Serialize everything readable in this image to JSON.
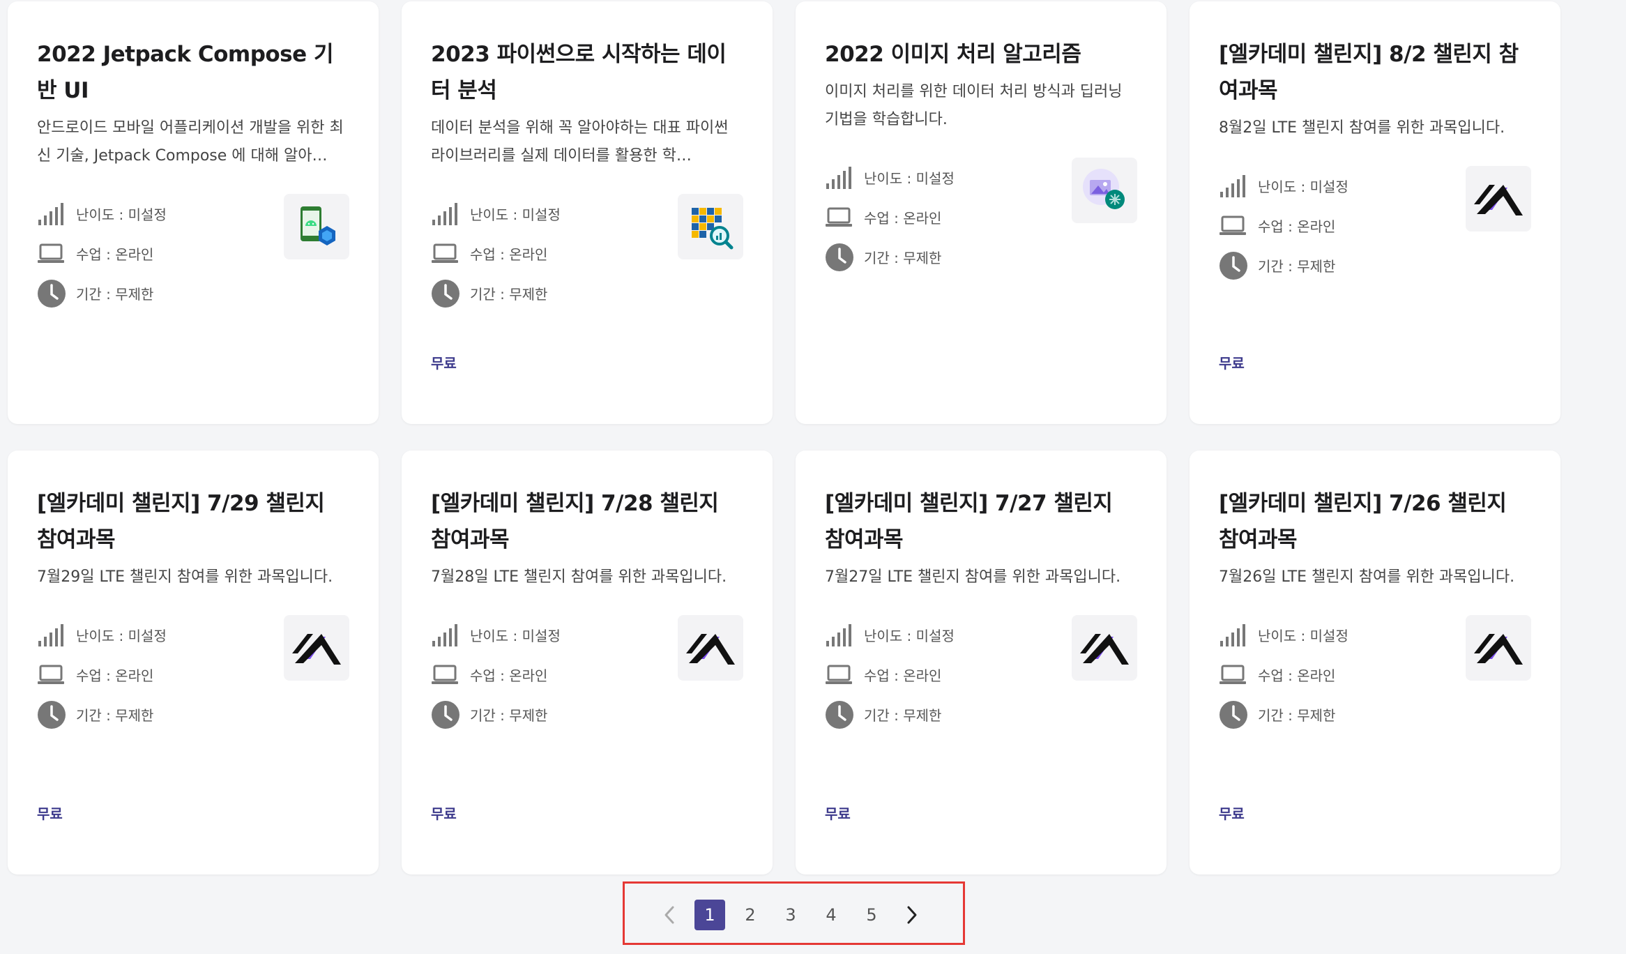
{
  "cards": [
    {
      "title": "2022 Jetpack Compose 기반 UI",
      "desc": "안드로이드 모바일 어플리케이션 개발을 위한 최신 기술, Jetpack Compose 에 대해 알아…",
      "difficulty": "난이도 : 미설정",
      "class_type": "수업 : 온라인",
      "period": "기간 : 무제한",
      "price": "",
      "thumb": "android-compose-icon"
    },
    {
      "title": "2023 파이썬으로 시작하는 데이터 분석",
      "desc": "데이터 분석을 위해 꼭 알아야하는 대표 파이썬 라이브러리를 실제 데이터를 활용한 학…",
      "difficulty": "난이도 : 미설정",
      "class_type": "수업 : 온라인",
      "period": "기간 : 무제한",
      "price": "무료",
      "thumb": "data-grid-search-icon"
    },
    {
      "title": "2022 이미지 처리 알고리즘",
      "desc": "이미지 처리를 위한 데이터 처리 방식과 딥러닝 기법을 학습합니다.",
      "difficulty": "난이도 : 미설정",
      "class_type": "수업 : 온라인",
      "period": "기간 : 무제한",
      "price": "",
      "thumb": "image-brain-icon"
    },
    {
      "title": "[엘카데미 챌린지] 8/2 챌린지 참여과목",
      "desc": "8월2일 LTE 챌린지 참여를 위한 과목입니다.",
      "difficulty": "난이도 : 미설정",
      "class_type": "수업 : 온라인",
      "period": "기간 : 무제한",
      "price": "무료",
      "thumb": "elice-logo"
    },
    {
      "title": "[엘카데미 챌린지] 7/29 챌린지 참여과목",
      "desc": "7월29일 LTE 챌린지 참여를 위한 과목입니다.",
      "difficulty": "난이도 : 미설정",
      "class_type": "수업 : 온라인",
      "period": "기간 : 무제한",
      "price": "무료",
      "thumb": "elice-logo"
    },
    {
      "title": "[엘카데미 챌린지] 7/28 챌린지 참여과목",
      "desc": "7월28일 LTE 챌린지 참여를 위한 과목입니다.",
      "difficulty": "난이도 : 미설정",
      "class_type": "수업 : 온라인",
      "period": "기간 : 무제한",
      "price": "무료",
      "thumb": "elice-logo"
    },
    {
      "title": "[엘카데미 챌린지] 7/27 챌린지 참여과목",
      "desc": "7월27일 LTE 챌린지 참여를 위한 과목입니다.",
      "difficulty": "난이도 : 미설정",
      "class_type": "수업 : 온라인",
      "period": "기간 : 무제한",
      "price": "무료",
      "thumb": "elice-logo"
    },
    {
      "title": "[엘카데미 챌린지] 7/26 챌린지 참여과목",
      "desc": "7월26일 LTE 챌린지 참여를 위한 과목입니다.",
      "difficulty": "난이도 : 미설정",
      "class_type": "수업 : 온라인",
      "period": "기간 : 무제한",
      "price": "무료",
      "thumb": "elice-logo"
    }
  ],
  "pagination": {
    "prev_icon": "chevron-left-icon",
    "pages": [
      "1",
      "2",
      "3",
      "4",
      "5"
    ],
    "current": "1",
    "next_icon": "chevron-right-icon"
  },
  "colors": {
    "accent": "#4b4697",
    "price": "#3d3a8c",
    "highlight_border": "#e53935",
    "background": "#f4f5f7"
  }
}
